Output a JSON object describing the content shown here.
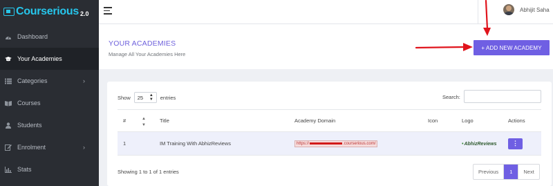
{
  "brand": {
    "name": "Courserious",
    "version": "2.0"
  },
  "sidebar": {
    "items": [
      {
        "label": "Dashboard",
        "icon": "dashboard-icon",
        "active": false,
        "has_children": false
      },
      {
        "label": "Your Academies",
        "icon": "graduation-cap-icon",
        "active": true,
        "has_children": false
      },
      {
        "label": "Categories",
        "icon": "list-icon",
        "active": false,
        "has_children": true
      },
      {
        "label": "Courses",
        "icon": "book-icon",
        "active": false,
        "has_children": false
      },
      {
        "label": "Students",
        "icon": "user-icon",
        "active": false,
        "has_children": false
      },
      {
        "label": "Enrolment",
        "icon": "enrolment-icon",
        "active": false,
        "has_children": true
      },
      {
        "label": "Stats",
        "icon": "chart-icon",
        "active": false,
        "has_children": false
      }
    ]
  },
  "topbar": {
    "user_name": "Abhijit Saha"
  },
  "page": {
    "title": "YOUR ACADEMIES",
    "subtitle": "Manage All Your Academies Here",
    "add_button": "+ ADD NEW ACADEMY"
  },
  "table_controls": {
    "show_label": "Show",
    "entries_value": "25",
    "entries_label": "entries",
    "search_label": "Search:",
    "search_value": ""
  },
  "table": {
    "columns": [
      "#",
      "Title",
      "Academy Domain",
      "Icon",
      "Logo",
      "Actions"
    ],
    "rows": [
      {
        "num": "1",
        "title": "IM Training With AbhizReviews",
        "domain_prefix": "https://",
        "domain_suffix": ".courserious.com/",
        "icon": "",
        "logo": "AbhizReviews",
        "action": "⋮"
      }
    ]
  },
  "footer": {
    "info": "Showing 1 to 1 of 1 entries",
    "prev": "Previous",
    "page": "1",
    "next": "Next"
  },
  "colors": {
    "sidebar_bg": "#2a2d33",
    "accent": "#6f5fe3",
    "title_color": "#6e61dc",
    "brand_cyan": "#26c6ec",
    "annotation_red": "#e0141c"
  }
}
